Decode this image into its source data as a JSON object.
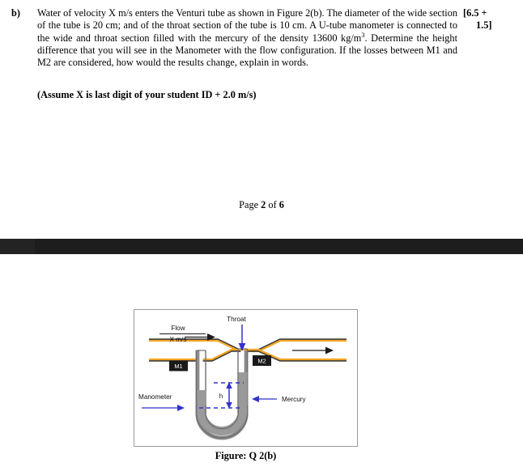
{
  "question": {
    "label": "b)",
    "body_before_sup": "Water of velocity X m/s enters the Venturi tube as shown in Figure 2(b). The diameter of the wide section of the tube is 20 cm; and of the throat section of the tube is 10 cm. A U-tube manometer is connected to the wide and throat section filled with the mercury of the density 13600 kg/m",
    "body_sup": "3",
    "body_after_sup": ". Determine the height difference that you will see in the Manometer with the flow configuration. If the losses between M1 and M2 are considered, how would the results change, explain in words.",
    "assumption": "(Assume X is last digit of your student ID + 2.0 m/s)",
    "marks_line1": "[6.5 +",
    "marks_line2": "1.5]"
  },
  "footer": {
    "prefix": "Page ",
    "current_page": "2",
    "middle": " of ",
    "total_pages": "6"
  },
  "figure": {
    "caption": "Figure: Q 2(b)",
    "labels": {
      "throat": "Throat",
      "flow": "Flow",
      "velocity": "X m/s",
      "m1": "M1",
      "m2": "M2",
      "manometer": "Manometer",
      "mercury": "Mercury",
      "height": "h"
    },
    "colors": {
      "pipe_wall": "#f5a623",
      "pipe_wall_dark": "#3c3c3c",
      "mercury_fill": "#9a9a9a",
      "annotation_blue": "#3333cc",
      "arrow_black": "#222222",
      "chip_bg": "#1a1a1a",
      "frame_border": "#9a9a9a"
    }
  }
}
